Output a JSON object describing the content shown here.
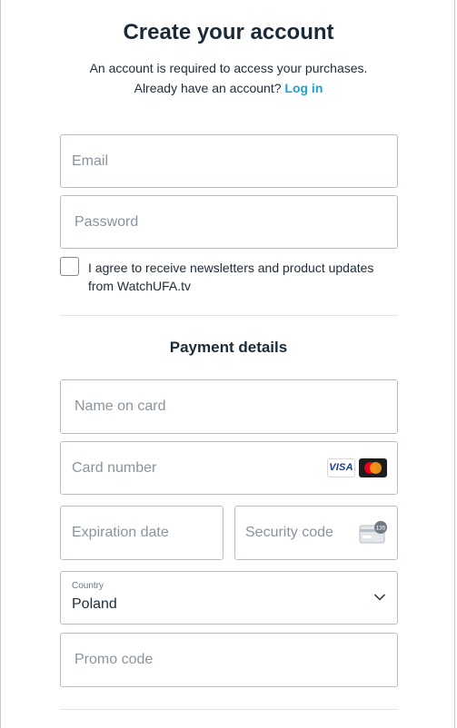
{
  "header": {
    "title": "Create your account",
    "subtitle": "An account is required to access your purchases.",
    "login_prompt": "Already have an account?",
    "login_link": "Log in"
  },
  "account": {
    "email_placeholder": "Email",
    "email_value": "",
    "password_placeholder": "Password",
    "password_value": "",
    "newsletter_checked": false,
    "newsletter_label": "I agree to receive newsletters and product updates from WatchUFA.tv"
  },
  "payment": {
    "title": "Payment details",
    "name_placeholder": "Name on card",
    "card_placeholder": "Card number",
    "card_brands": [
      "VISA",
      "mastercard-icon"
    ],
    "visa_label": "VISA",
    "expiry_placeholder": "Expiration date",
    "cvc_placeholder": "Security code",
    "cvc_icon_text": "135",
    "country_label": "Country",
    "country_value": "Poland",
    "promo_placeholder": "Promo code"
  },
  "colors": {
    "link": "#1a9fd6",
    "title": "#1c2a38",
    "border": "#b9bec4",
    "placeholder": "#8a949e"
  }
}
